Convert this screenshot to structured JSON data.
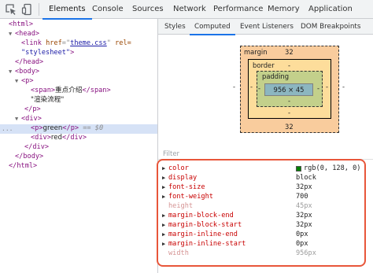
{
  "toolbar": {
    "tabs": [
      "Elements",
      "Console",
      "Sources",
      "Network",
      "Performance",
      "Memory",
      "Application"
    ],
    "active_tab": "Elements"
  },
  "dom": {
    "html_open": "<html>",
    "head_open": "<head>",
    "link_tag": "<link",
    "link_href_attr": "href",
    "link_href_val": "theme.css",
    "link_rel_attr": "rel=",
    "link_rel_val": "\"stylesheet\"",
    "link_close": ">",
    "head_close": "</head>",
    "body_open": "<body>",
    "p_open": "<p>",
    "span_open": "<span>",
    "span_text": "重点介绍",
    "span_close": "</span>",
    "p_text": "\"渲染流程\"",
    "p_close": "</p>",
    "div_open": "<div>",
    "selected_p_open": "<p>",
    "selected_text": "green",
    "selected_p_close": "</p>",
    "selected_marker": "== $0",
    "inner_div_open": "<div>",
    "inner_div_text": "red",
    "inner_div_close": "</div>",
    "div_close": "</div>",
    "body_close": "</body>",
    "html_close": "</html>",
    "ellipsis": "..."
  },
  "subtabs": {
    "items": [
      "Styles",
      "Computed",
      "Event Listeners",
      "DOM Breakpoints"
    ],
    "active": "Computed"
  },
  "box_model": {
    "margin_label": "margin",
    "margin_top": "32",
    "margin_bottom": "32",
    "margin_left": "-",
    "margin_right": "-",
    "border_label": "border",
    "border_top": "-",
    "border_bottom": "-",
    "border_left": "-",
    "border_right": "-",
    "padding_label": "padding",
    "padding_bottom": "-",
    "padding_left": "-",
    "padding_right": "-",
    "content_size": "956 × 45"
  },
  "filter": {
    "placeholder": "Filter"
  },
  "computed": {
    "color_swatch": "#008000",
    "properties": [
      {
        "name": "color",
        "value": "rgb(0, 128, 0)"
      },
      {
        "name": "display",
        "value": "block"
      },
      {
        "name": "font-size",
        "value": "32px"
      },
      {
        "name": "font-weight",
        "value": "700"
      },
      {
        "name": "height",
        "value": "45px"
      },
      {
        "name": "margin-block-end",
        "value": "32px"
      },
      {
        "name": "margin-block-start",
        "value": "32px"
      },
      {
        "name": "margin-inline-end",
        "value": "0px"
      },
      {
        "name": "margin-inline-start",
        "value": "0px"
      },
      {
        "name": "width",
        "value": "956px"
      }
    ]
  },
  "colors": {
    "highlight_border": "#e8563a",
    "selected_row": "#d6e2f6",
    "active_tab_underline": "#1a73e8"
  }
}
